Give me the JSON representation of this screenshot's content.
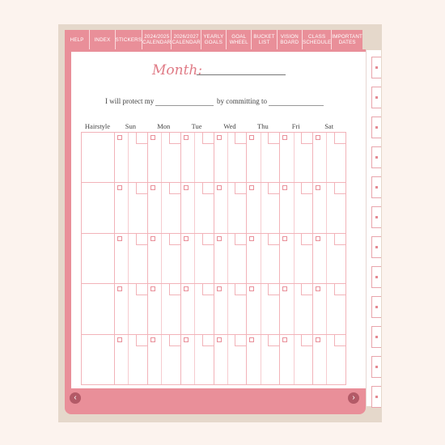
{
  "tabs": [
    {
      "label": "HELP"
    },
    {
      "label": "INDEX"
    },
    {
      "label": "STICKERS"
    },
    {
      "label": "2024/2025\nCALENDAR"
    },
    {
      "label": "2026/2027\nCALENDAR"
    },
    {
      "label": "YEARLY\nGOALS"
    },
    {
      "label": "GOAL\nWHEEL"
    },
    {
      "label": "BUCKET\nLIST"
    },
    {
      "label": "VISION\nBOARD"
    },
    {
      "label": "CLASS\nSCHEDULE"
    },
    {
      "label": "IMPORTANT\nDATES"
    }
  ],
  "page": {
    "month_label": "Month:",
    "pledge_part1": "I will protect my",
    "pledge_part2": "by committing to",
    "first_column": "Hairstyle",
    "days": [
      "Sun",
      "Mon",
      "Tue",
      "Wed",
      "Thu",
      "Fri",
      "Sat"
    ]
  },
  "nav": {
    "prev": "‹",
    "next": "›"
  },
  "colors": {
    "accent": "#e98f99",
    "grid": "#f2b3b9",
    "nav": "#b35a67",
    "backdrop": "#e5d8cb"
  }
}
